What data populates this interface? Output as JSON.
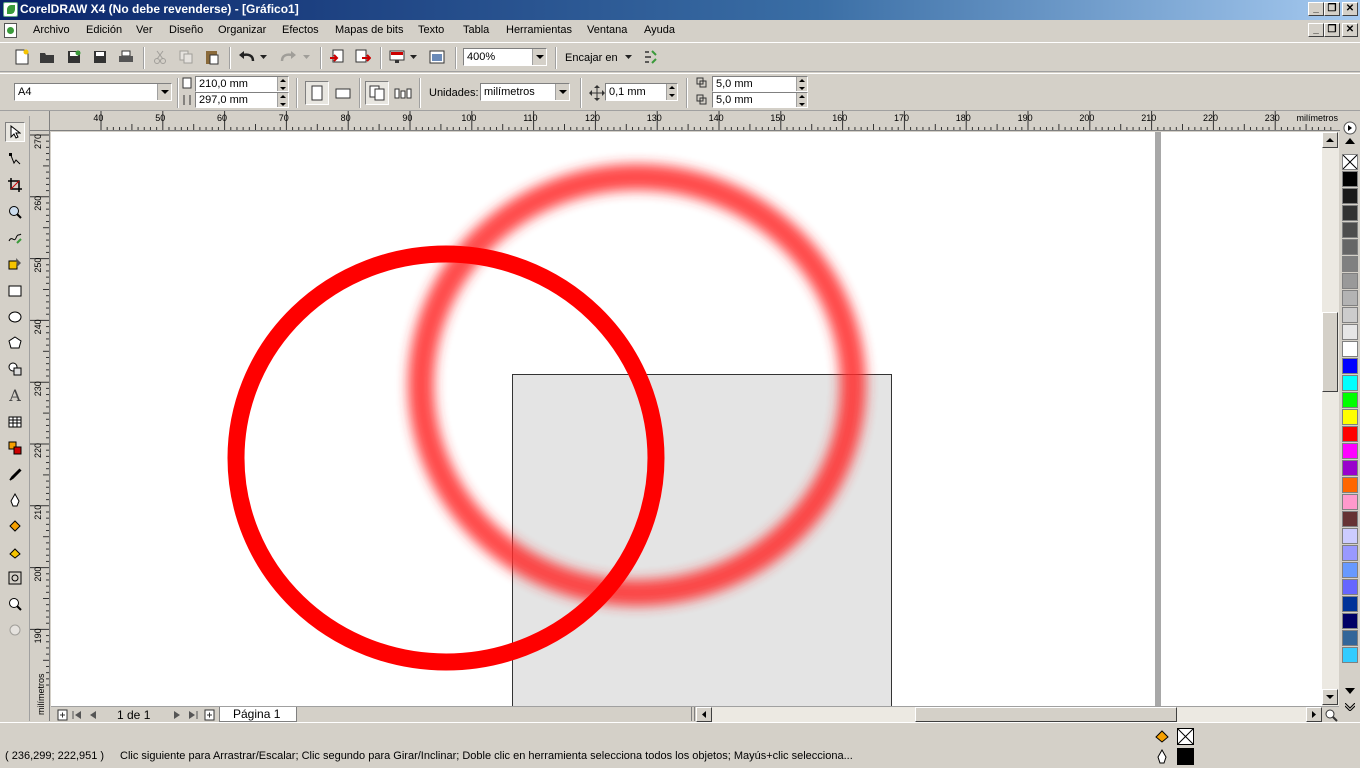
{
  "window": {
    "title": "CorelDRAW X4 (No debe revenderse) - [Gráfico1]"
  },
  "menu": [
    "Archivo",
    "Edición",
    "Ver",
    "Diseño",
    "Organizar",
    "Efectos",
    "Mapas de bits",
    "Texto",
    "Tabla",
    "Herramientas",
    "Ventana",
    "Ayuda"
  ],
  "standard_toolbar": {
    "zoom": "400%",
    "snap_label": "Encajar en"
  },
  "property_bar": {
    "page_size": "A4",
    "width": "210,0 mm",
    "height": "297,0 mm",
    "units_label": "Unidades:",
    "units_value": "milímetros",
    "nudge": "0,1 mm",
    "dup_x": "5,0 mm",
    "dup_y": "5,0 mm"
  },
  "rulers": {
    "horizontal_ticks": [
      "40",
      "50",
      "60",
      "70",
      "80",
      "90",
      "100",
      "110",
      "120",
      "130",
      "140",
      "150",
      "160",
      "170",
      "180",
      "190",
      "200",
      "210",
      "220",
      "230"
    ],
    "horizontal_unit": "milímetros",
    "vertical_ticks": [
      "270",
      "260",
      "250",
      "240",
      "230",
      "220",
      "210",
      "200",
      "190"
    ],
    "vertical_unit": "milímetros"
  },
  "page_nav": {
    "counter": "1 de 1",
    "tab": "Página 1"
  },
  "status": {
    "coords": "( 236,299; 222,951 )",
    "message": "Clic siguiente para Arrastrar/Escalar; Clic segundo para Girar/Inclinar; Doble clic en herramienta selecciona todos los objetos; Mayús+clic selecciona..."
  },
  "palette_colors": [
    "#000000",
    "#1a1a1a",
    "#333333",
    "#4d4d4d",
    "#666666",
    "#808080",
    "#999999",
    "#b3b3b3",
    "#cccccc",
    "#e6e6e6",
    "#ffffff",
    "#0000ff",
    "#00ffff",
    "#00ff00",
    "#ffff00",
    "#ff0000",
    "#ff00ff",
    "#9900cc",
    "#ff6600",
    "#ff99cc",
    "#663333",
    "#ccccff",
    "#9999ff",
    "#6699ff",
    "#6666ff",
    "#003399",
    "#000066",
    "#336699",
    "#33ccff"
  ],
  "colors": {
    "title_start": "#0a246a",
    "ring_red": "#ff0000",
    "rect_fill": "#e4e4e4",
    "chrome": "#d4d0c8"
  }
}
